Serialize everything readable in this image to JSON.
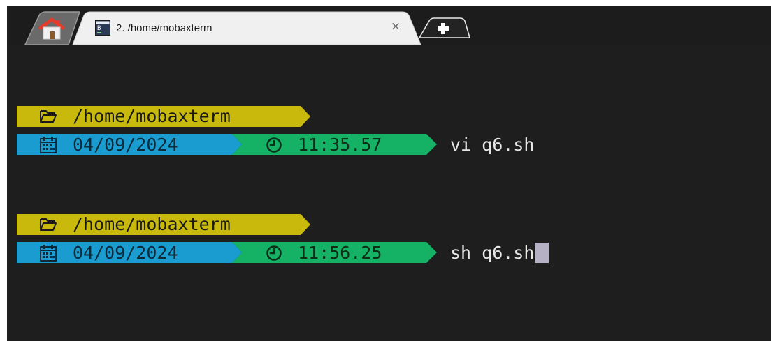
{
  "tabs": {
    "home_tab": {
      "icon": "home-icon"
    },
    "terminal_tab": {
      "icon": "terminal-session-icon",
      "title": "2. /home/mobaxterm",
      "close_label": "×"
    },
    "new_tab": {
      "icon": "plus-icon"
    }
  },
  "terminal": {
    "prompts": [
      {
        "folder_icon": "folder-icon",
        "path": "/home/mobaxterm",
        "calendar_icon": "calendar-icon",
        "date": "04/09/2024",
        "clock_icon": "clock-icon",
        "time": "11:35.57",
        "command": "vi q6.sh"
      },
      {
        "folder_icon": "folder-icon",
        "path": "/home/mobaxterm",
        "calendar_icon": "calendar-icon",
        "date": "04/09/2024",
        "clock_icon": "clock-icon",
        "time": "11:56.25",
        "command": "sh q6.sh"
      }
    ]
  },
  "colors": {
    "terminal_bg": "#1e1e1e",
    "tabbar_bg": "#1c1c1c",
    "path_segment": "#c8b90c",
    "date_segment": "#1a9cd0",
    "time_segment": "#15b265",
    "cursor": "#b6b1c4",
    "command_text": "#e6e6e6"
  }
}
